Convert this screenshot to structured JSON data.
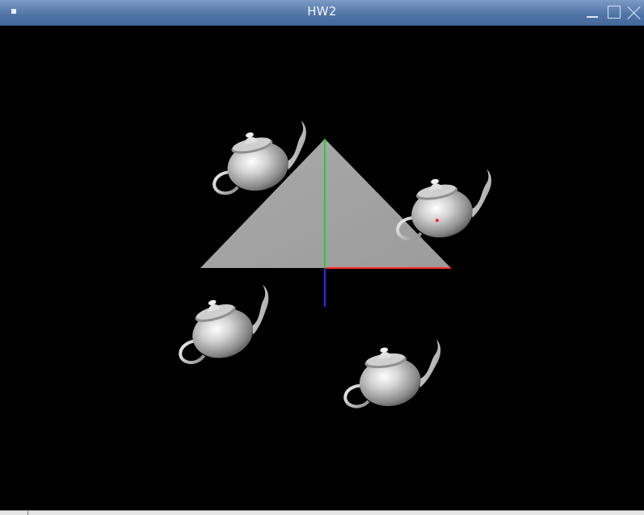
{
  "window": {
    "title": "HW2",
    "controls": [
      "minimize",
      "maximize",
      "close"
    ]
  },
  "scene": {
    "background_color": "#000000",
    "objects": [
      "triangle",
      "axes",
      "teapot",
      "teapot",
      "teapot",
      "teapot",
      "point"
    ],
    "axis_colors": {
      "x": "#ff2a2a",
      "y": "#22d022",
      "z": "#2a2aff"
    },
    "triangle_color": "#a8a8a8",
    "teapot_color": "#bdbdbd",
    "point_color": "#ff2020"
  }
}
